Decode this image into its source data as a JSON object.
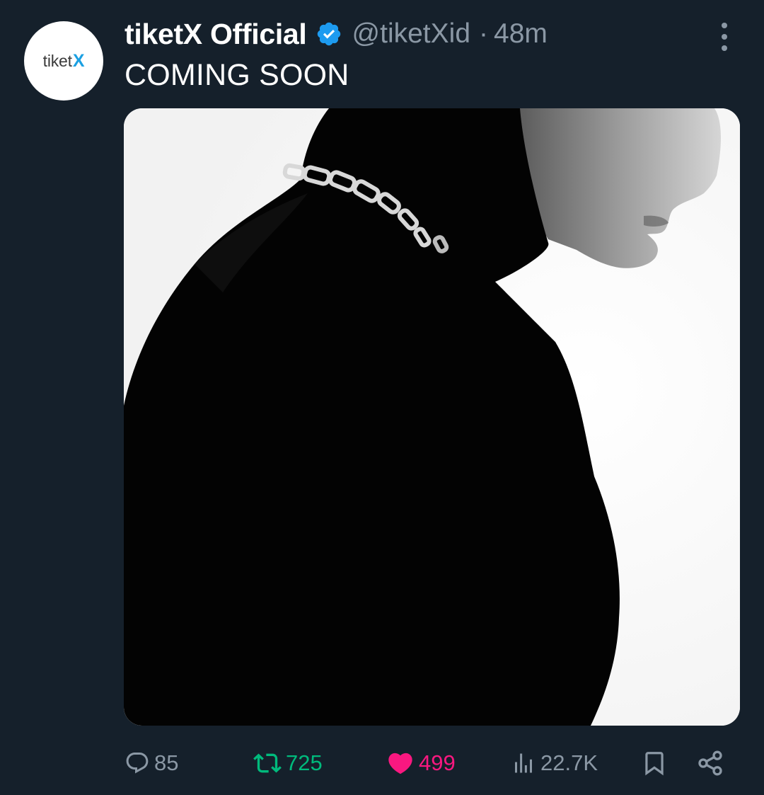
{
  "tweet": {
    "avatar_logo": {
      "text": "tiket",
      "mark": "X"
    },
    "display_name": "tiketX Official",
    "verified_icon": "verified-badge-icon",
    "handle": "@tiketXid",
    "separator": "·",
    "time": "48m",
    "text": "COMING SOON",
    "media_description": "black and white photo, silhouette of person in black turtleneck with silver chain necklace"
  },
  "actions": {
    "reply": {
      "icon": "comment-icon",
      "count": "85"
    },
    "retweet": {
      "icon": "retweet-icon",
      "count": "725",
      "color": "#00ba7c"
    },
    "like": {
      "icon": "heart-icon",
      "count": "499",
      "color": "#f91880"
    },
    "views": {
      "icon": "views-bar-chart-icon",
      "count": "22.7K"
    },
    "bookmark": {
      "icon": "bookmark-icon"
    },
    "share": {
      "icon": "share-icon"
    }
  },
  "colors": {
    "background": "#15202b",
    "secondary_text": "#8b98a5",
    "verified": "#1d9bf0",
    "brand_logo_x": "#1ba0e2"
  }
}
